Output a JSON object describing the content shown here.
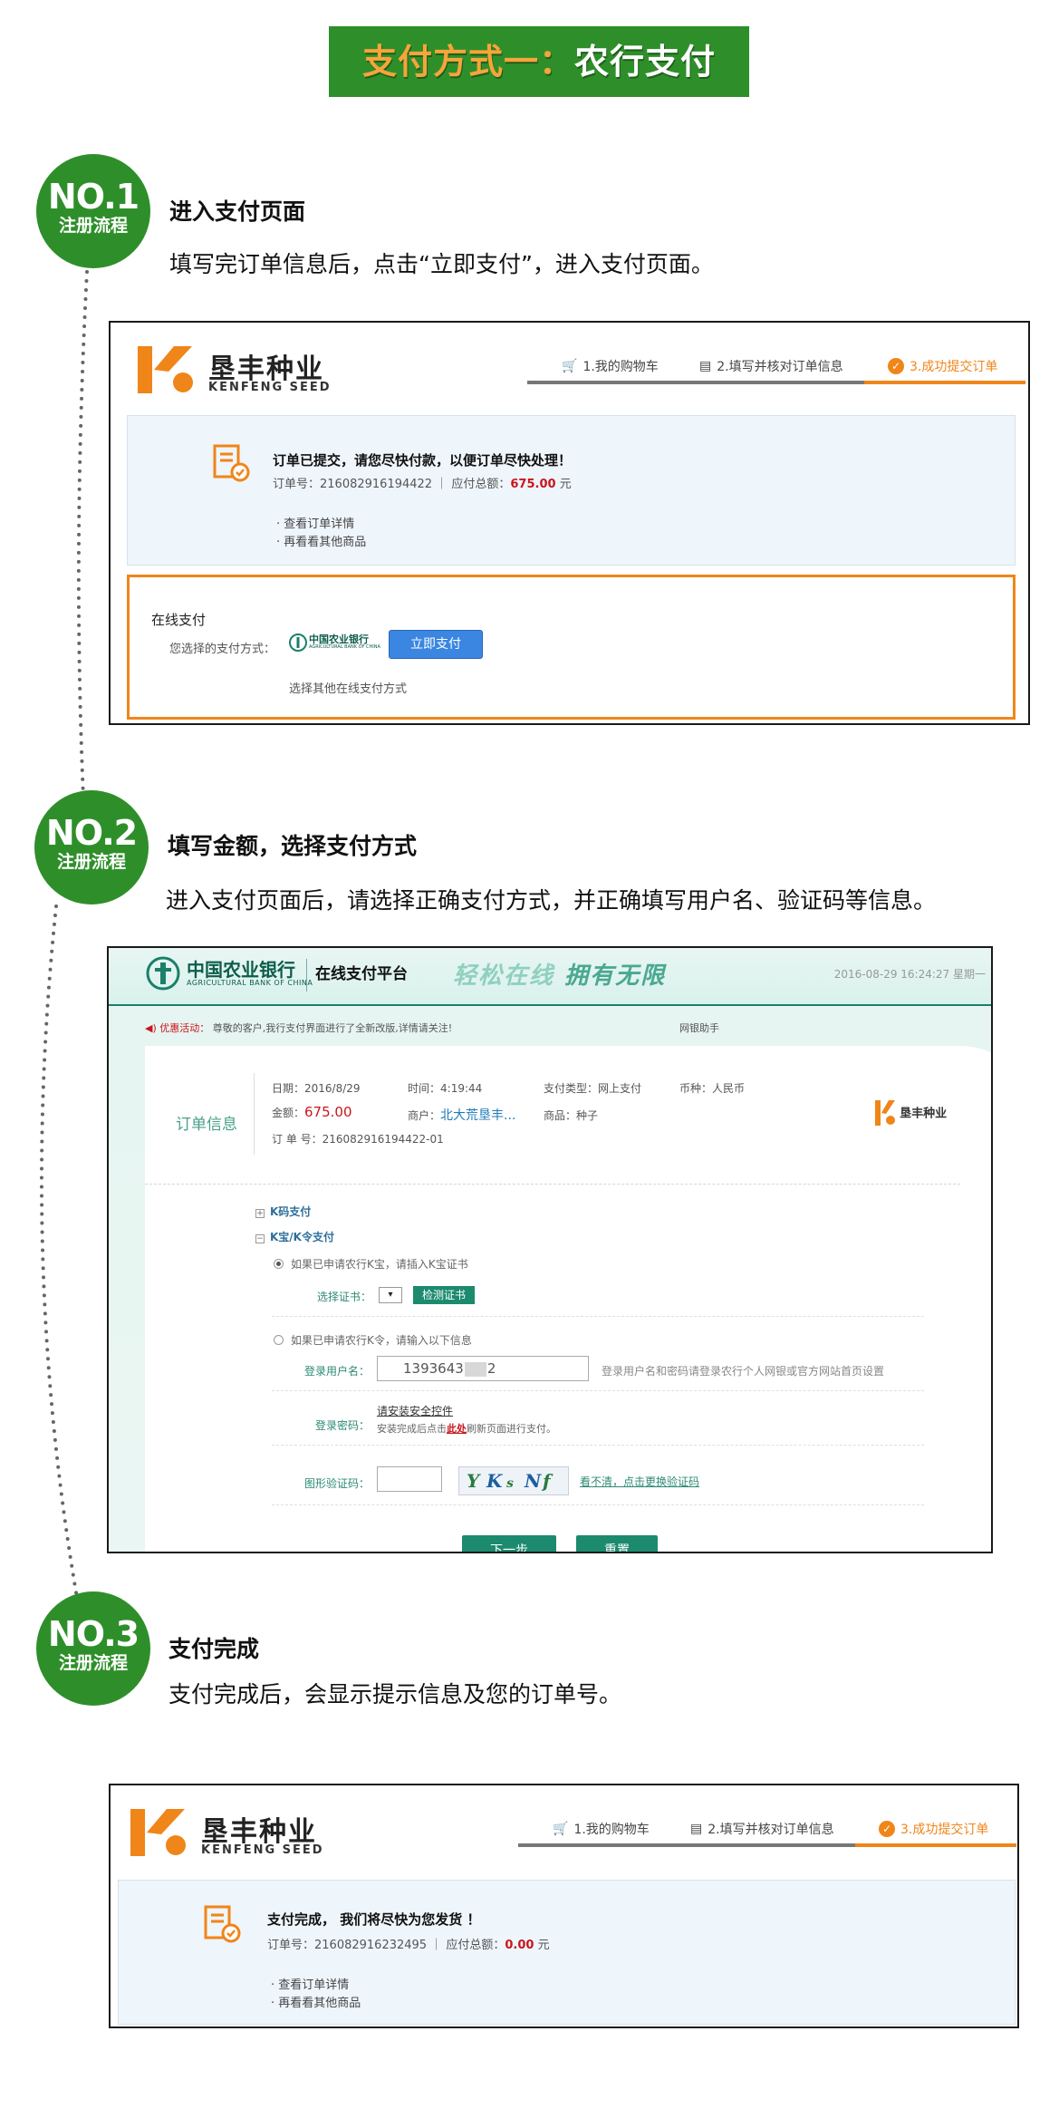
{
  "banner": {
    "prefix": "支付方式一：",
    "method": "农行支付"
  },
  "badge_sub": "注册流程",
  "steps": [
    {
      "no": "NO.1",
      "title": "进入支付页面",
      "desc": "填写完订单信息后，点击“立即支付”，进入支付页面。"
    },
    {
      "no": "NO.2",
      "title": "填写金额，选择支付方式",
      "desc": "进入支付页面后，请选择正确支付方式，并正确填写用户名、验证码等信息。"
    },
    {
      "no": "NO.3",
      "title": "支付完成",
      "desc": "支付完成后，会显示提示信息及您的订单号。"
    }
  ],
  "kenfeng": {
    "name": "垦丰种业",
    "en": "KENFENG SEED",
    "progress": [
      "1.我的购物车",
      "2.填写并核对订单信息",
      "3.成功提交订单"
    ]
  },
  "shot1": {
    "heading": "订单已提交，请您尽快付款，以便订单尽快处理！",
    "order_label": "订单号：",
    "order_no": "216082916194422",
    "total_label": "应付总额：",
    "total": "675.00",
    "currency": "元",
    "links": [
      "· 查看订单详情",
      "· 再看看其他商品"
    ],
    "online_title": "在线支付",
    "selected_label": "您选择的支付方式：",
    "bank_logo_text": "中国农业银行",
    "bank_logo_en": "AGRICULTURAL BANK OF CHINA",
    "pay_button": "立即支付",
    "other_methods": "选择其他在线支付方式"
  },
  "shot2": {
    "bank_name": "中国农业银行",
    "bank_en": "AGRICULTURAL BANK OF CHINA",
    "platform": "在线支付平台",
    "slogan_a": "轻松在线",
    "slogan_b": "拥有无限",
    "datetime": "2016-08-29 16:24:27 星期一",
    "promo_label": "优惠活动：",
    "promo_text": "尊敬的客户,我行支付界面进行了全新改版,详情请关注!",
    "help": "网银助手",
    "order_info_label": "订单信息",
    "date_label": "日期：",
    "date": "2016/8/29",
    "time_label": "时间：",
    "time": "4:19:44",
    "pay_type_label": "支付类型：",
    "pay_type": "网上支付",
    "currency_label": "币种：",
    "currency": "人民币",
    "amount_label": "金额：",
    "amount": "675.00",
    "merchant_label": "商户：",
    "merchant": "北大荒垦丰...",
    "goods_label": "商品：",
    "goods": "种子",
    "order_label": "订 单 号：",
    "order_no": "216082916194422-01",
    "kcode": "K码支付",
    "kbao": "K宝/K令支付",
    "radio1": "如果已申请农行K宝，请插入K宝证书",
    "cert_label": "选择证书：",
    "cert_value": "▾",
    "check_cert": "检测证书",
    "radio2": "如果已申请农行K令，请输入以下信息",
    "user_label": "登录用户名：",
    "user_prefix": "1393643",
    "user_suffix": "2",
    "user_hint": "登录用户名和密码请登录农行个人网银或官方网站首页设置",
    "pwd_label": "登录密码：",
    "install_ctl": "请安装安全控件",
    "tip_a": "安装完成后点击",
    "tip_link": "此处",
    "tip_b": "刷新页面进行支付。",
    "captcha_label": "图形验证码：",
    "captcha_chars": [
      "Y",
      "K",
      "s",
      "N",
      "f"
    ],
    "refresh": "看不清，点击更换验证码",
    "next": "下一步",
    "reset": "重置"
  },
  "shot3": {
    "heading": "支付完成， 我们将尽快为您发货 ！",
    "order_label": "订单号：",
    "order_no": "216082916232495",
    "total_label": "应付总额：",
    "total": "0.00",
    "currency": "元",
    "links": [
      "· 查看订单详情",
      "· 再看看其他商品"
    ]
  }
}
